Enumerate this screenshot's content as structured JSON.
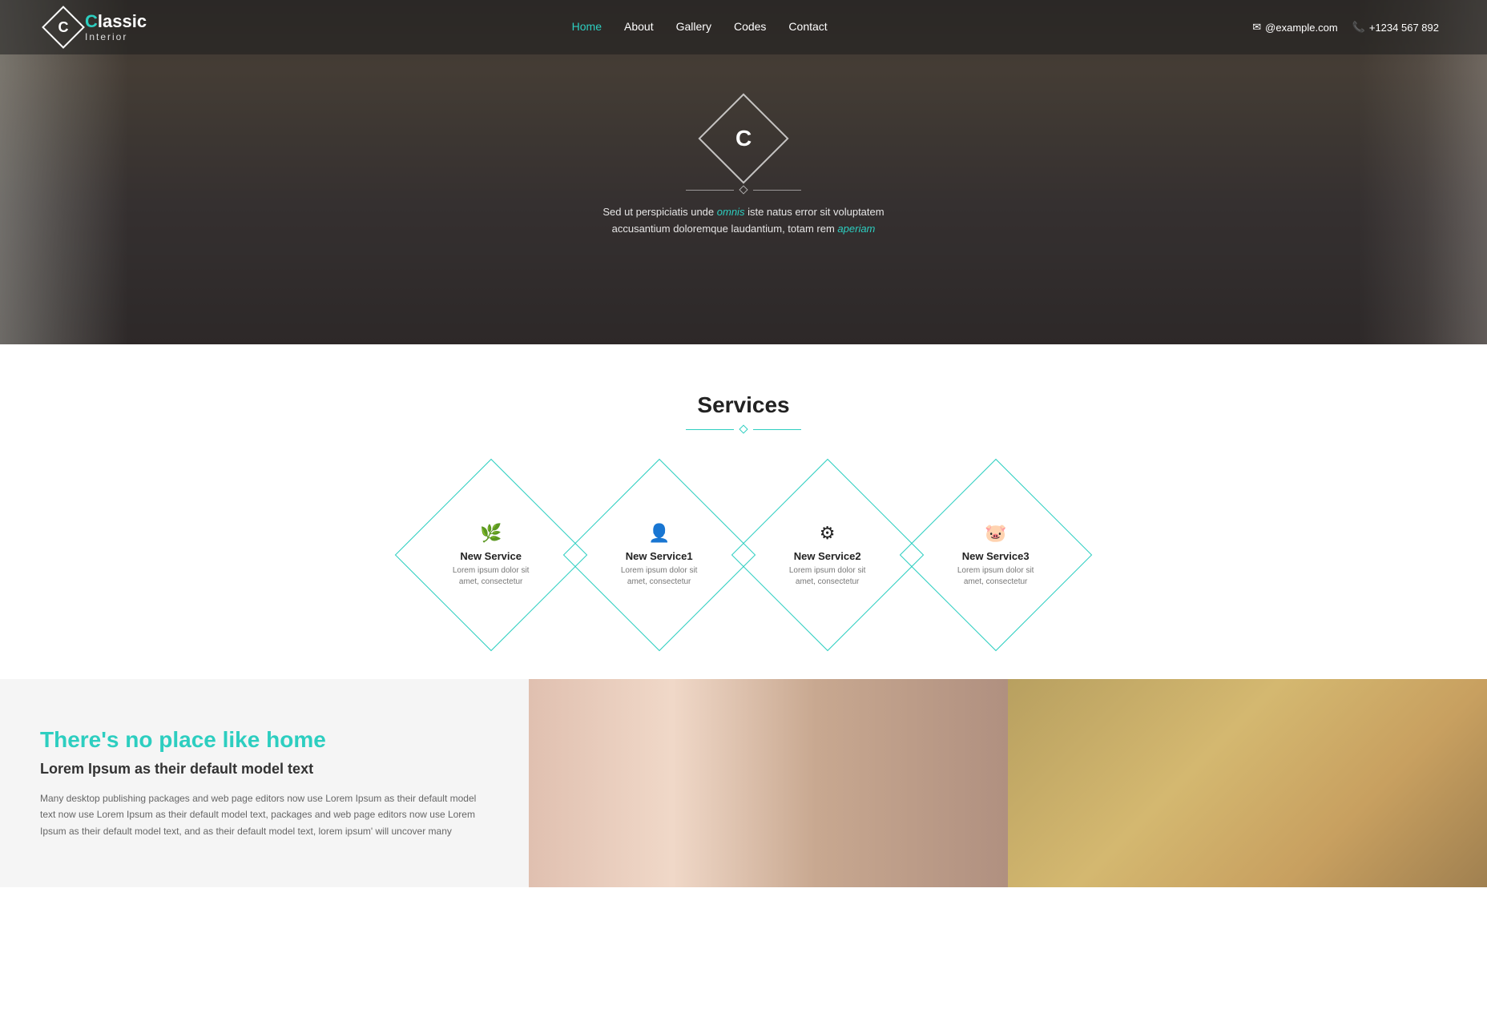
{
  "nav": {
    "logo_letter": "C",
    "brand": "lassic",
    "sub": "Interior",
    "links": [
      {
        "label": "Home",
        "active": true
      },
      {
        "label": "About",
        "active": false
      },
      {
        "label": "Gallery",
        "active": false
      },
      {
        "label": "Codes",
        "active": false
      },
      {
        "label": "Contact",
        "active": false
      }
    ],
    "email": "@example.com",
    "phone": "+1234 567 892"
  },
  "hero": {
    "letter": "C",
    "text": "Sed ut perspiciatis unde omnis iste natus error sit voluptatem accusantium doloremque laudantium, totam rem aperiam"
  },
  "services": {
    "title": "Services",
    "items": [
      {
        "name": "New Service",
        "desc": "Lorem ipsum dolor sit amet, consectetur",
        "icon": "🌿"
      },
      {
        "name": "New Service1",
        "desc": "Lorem ipsum dolor sit amet, consectetur",
        "icon": "👤"
      },
      {
        "name": "New Service2",
        "desc": "Lorem ipsum dolor sit amet, consectetur",
        "icon": "⚙"
      },
      {
        "name": "New Service3",
        "desc": "Lorem ipsum dolor sit amet, consectetur",
        "icon": "🐷"
      }
    ]
  },
  "about": {
    "title": "There's no place like home",
    "subtitle": "Lorem Ipsum as their default model text",
    "body": "Many desktop publishing packages and web page editors now use Lorem Ipsum as their default model text now use Lorem Ipsum as their default model text, packages and web page editors now use Lorem Ipsum as their default model text, and as their default model text, lorem ipsum' will uncover many"
  }
}
